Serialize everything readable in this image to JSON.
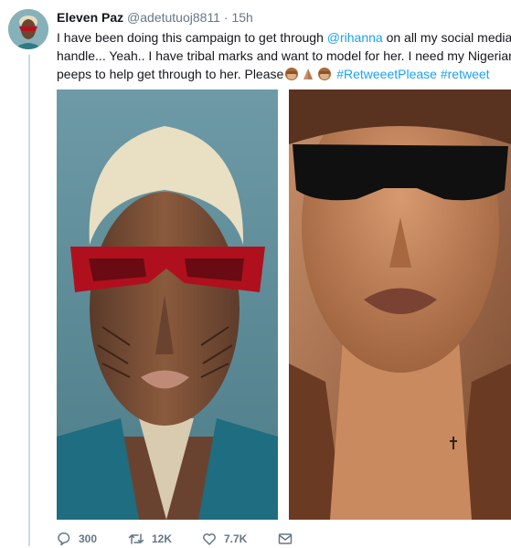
{
  "tweet": {
    "author_name": "Eleven Paz",
    "author_handle": "@adetutuoj8811",
    "separator": "·",
    "time": "15h",
    "text": {
      "line1_a": "I have been doing this campaign to get through ",
      "mention": "@rihanna",
      "line1_b": " on all my social media",
      "line2": "handle... Yeah.. I have tribal marks and want to model for her. I need my Nigerian",
      "line3_a": "peeps to help get through to her. Please",
      "hashtag1": "#RetweeetPlease",
      "hashtag2": "#retweet"
    },
    "emojis": [
      "see-no-evil-monkey-emoji",
      "folded-hands-emoji",
      "see-no-evil-monkey-emoji"
    ]
  },
  "actions": {
    "replies": "300",
    "retweets": "12K",
    "likes": "7.7K"
  },
  "colors": {
    "link": "#1da1f2",
    "text": "#14171a",
    "muted": "#657786",
    "thread_line": "#cdd9e4"
  }
}
